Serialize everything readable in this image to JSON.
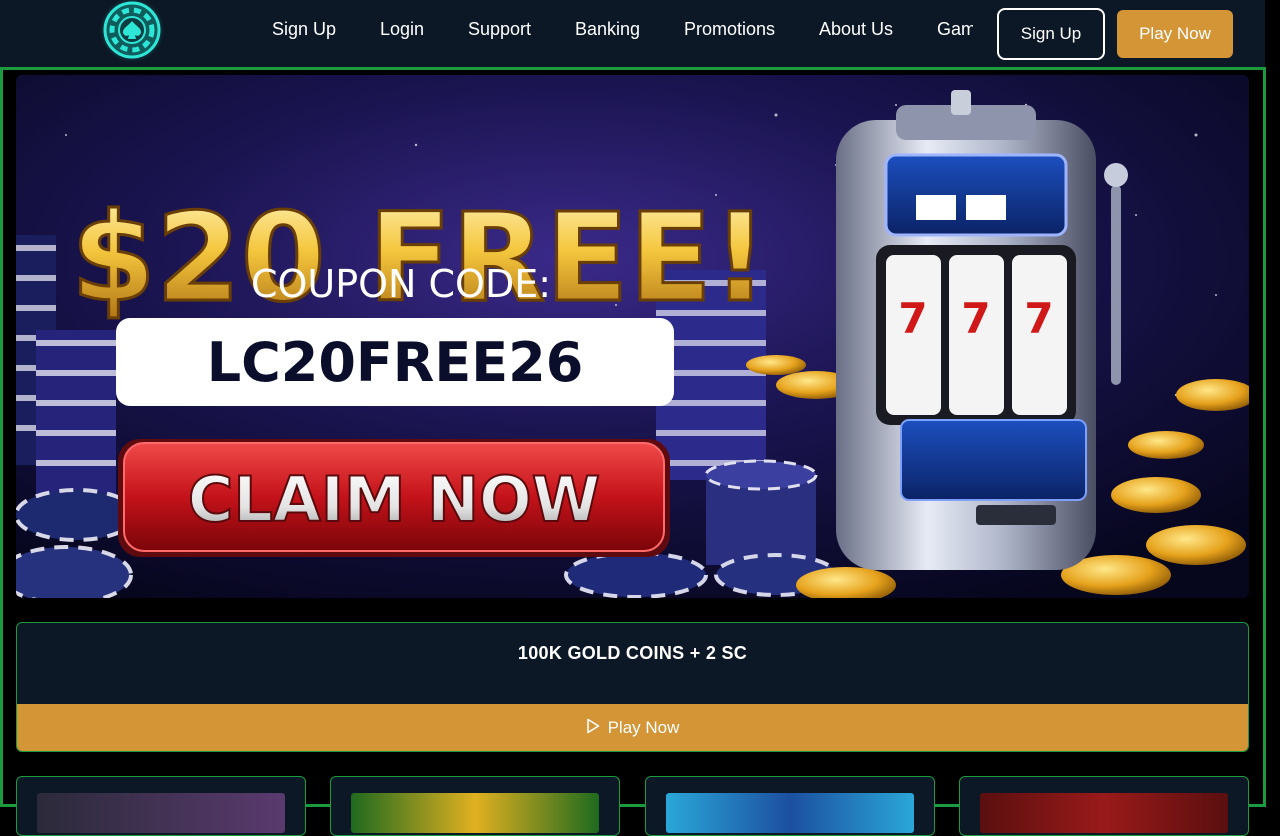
{
  "nav": {
    "logo_icon": "poker-chip-icon",
    "links": [
      "Sign Up",
      "Login",
      "Support",
      "Banking",
      "Promotions",
      "About Us",
      "Games"
    ],
    "signup_label": "Sign Up",
    "play_label": "Play Now"
  },
  "banner": {
    "headline": "$20 FREE!",
    "coupon_label": "COUPON CODE:",
    "coupon_code": "LC20FREE26",
    "cta_label": "CLAIM NOW"
  },
  "promo": {
    "title": "100K GOLD COINS + 2 SC",
    "button_label": "Play Now",
    "button_icon": "play-icon"
  },
  "colors": {
    "nav_bg": "#0c1826",
    "accent_gold": "#d39536",
    "frame_green": "#1c9a3e",
    "banner_red": "#c4121a"
  }
}
